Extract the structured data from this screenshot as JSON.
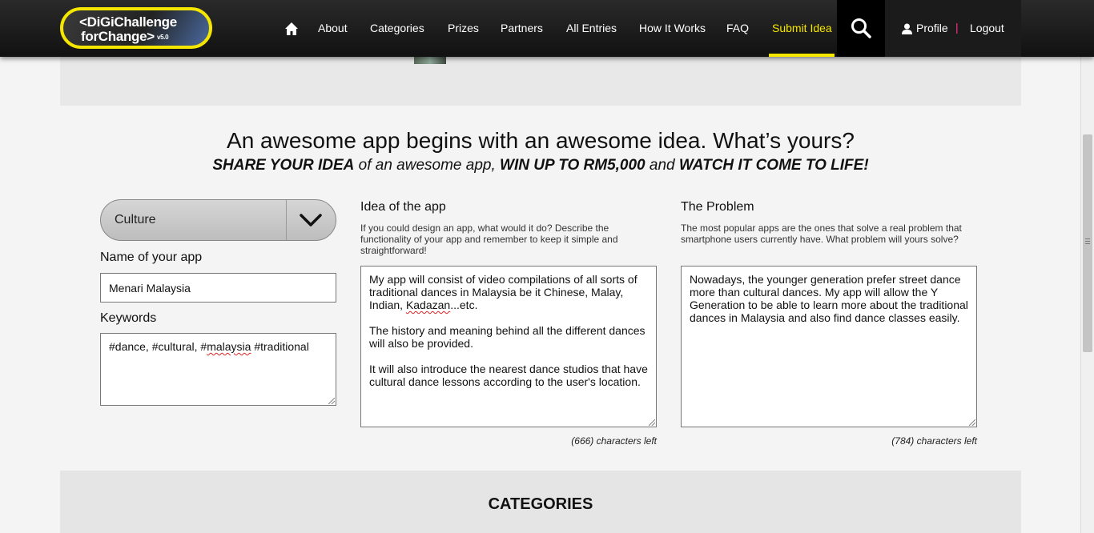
{
  "nav": {
    "logo_line1": "<DiGiChallenge",
    "logo_line2": "forChange>",
    "logo_version": "v5.0",
    "links": [
      "About",
      "Categories",
      "Prizes",
      "Partners",
      "All Entries",
      "How It Works",
      "FAQ",
      "Submit Idea"
    ],
    "active_link": "Submit Idea",
    "profile": "Profile",
    "separator": "|",
    "logout": "Logout"
  },
  "hero": {
    "headline": "An awesome app begins with an awesome idea. What’s yours?",
    "sub_part1": "SHARE YOUR IDEA",
    "sub_part2": " of an awesome app, ",
    "sub_part3": "WIN UP TO RM5,000",
    "sub_part4": " and ",
    "sub_part5": "WATCH IT COME TO LIFE!"
  },
  "form": {
    "category_value": "Culture",
    "name_label": "Name of your app",
    "name_value": "Menari Malaysia",
    "keywords_label": "Keywords",
    "keywords_part1": "#dance, #cultural, #",
    "keywords_part2": "malaysia",
    "keywords_part3": " #traditional"
  },
  "idea": {
    "title": "Idea of the app",
    "description": "If you could design an app, what would it do? Describe the functionality of your app and remember to keep it simple and straightforward!",
    "p1_part1": "My app will consist of video compilations of all sorts of traditional dances in Malaysia be it Chinese, Malay, Indian, ",
    "p1_part2": "Kadazan",
    "p1_part3": "...etc.",
    "p2": "The history and meaning behind all the different dances will also be provided.",
    "p3": "It will also introduce the nearest dance studios that have cultural dance lessons according to the user's location.",
    "counter": "(666) characters left"
  },
  "problem": {
    "title": "The Problem",
    "description": "The most popular apps are the ones that solve a real problem that smartphone users currently have. What problem will yours solve?",
    "text": "Nowadays, the younger generation prefer street dance more than cultural dances. My app will allow the Y Generation to be able to learn more about the traditional dances in Malaysia and also find dance classes easily.",
    "counter": "(784) characters left"
  },
  "categories": {
    "title": "CATEGORIES"
  },
  "colors": {
    "accent_yellow": "#f5e600",
    "separator_pink": "#ff2d8a",
    "nav_bg": "#1a1a1a"
  },
  "icons": [
    "home-icon",
    "search-icon",
    "profile-icon",
    "chevron-down-icon"
  ]
}
